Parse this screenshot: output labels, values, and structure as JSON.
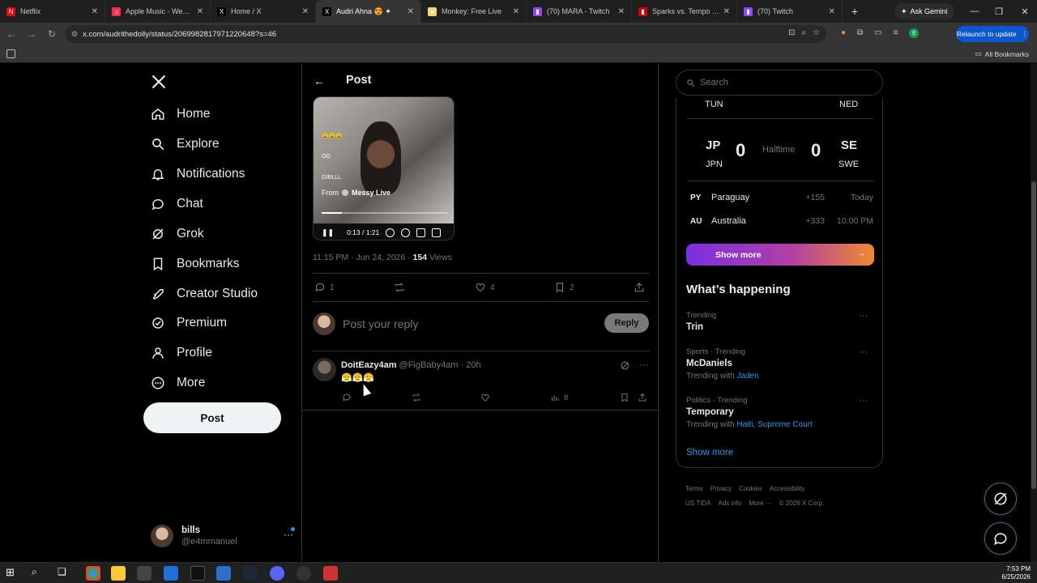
{
  "browser": {
    "tabs": [
      {
        "title": "Netflix",
        "fav_color": "#e50914",
        "fav": "N"
      },
      {
        "title": "Apple Music - Web Pla...",
        "fav_color": "#fa2d48",
        "fav": "♫"
      },
      {
        "title": "Home / X",
        "fav_color": "#000000",
        "fav": "X"
      },
      {
        "title": "Audri Ahna 😍 ✦",
        "fav_color": "#000000",
        "fav": "X"
      },
      {
        "title": "Monkey: Free Live",
        "fav_color": "#f5d76e",
        "fav": "●"
      },
      {
        "title": "(70) MARA - Twitch",
        "fav_color": "#9146ff",
        "fav": "▮"
      },
      {
        "title": "Sparks vs. Tempo (Jun...",
        "fav_color": "#d40000",
        "fav": "▮"
      },
      {
        "title": "(70) Twitch",
        "fav_color": "#9146ff",
        "fav": "▮"
      }
    ],
    "ask_gemini": "Ask Gemini",
    "url": "x.com/audrithedolly/status/2069982817971220648?s=46",
    "relaunch": "Relaunch to update",
    "all_bookmarks": "All Bookmarks"
  },
  "nav": {
    "items": [
      {
        "label": "Home",
        "icon": "home-icon"
      },
      {
        "label": "Explore",
        "icon": "search-icon"
      },
      {
        "label": "Notifications",
        "icon": "bell-icon"
      },
      {
        "label": "Chat",
        "icon": "chat-icon"
      },
      {
        "label": "Grok",
        "icon": "grok-icon"
      },
      {
        "label": "Bookmarks",
        "icon": "bookmark-icon"
      },
      {
        "label": "Creator Studio",
        "icon": "rocket-icon"
      },
      {
        "label": "Premium",
        "icon": "verified-icon"
      },
      {
        "label": "Profile",
        "icon": "person-icon"
      },
      {
        "label": "More",
        "icon": "more-circle-icon"
      }
    ],
    "post_button": "Post",
    "account": {
      "name": "bills",
      "handle": "@e4mmanuel"
    }
  },
  "post": {
    "header_title": "Post",
    "video": {
      "comments": [
        "😩😩😩",
        "GG",
        "GIRLLL"
      ],
      "from_label": "From",
      "from_source": "Messy Live",
      "time": "0:13 / 1:21",
      "progress": 0.16
    },
    "time": "11:15 PM · Jun 24, 2026 · ",
    "views_count": "154",
    "views_label": " Views",
    "replies": "1",
    "likes": "4",
    "bookmarks": "2",
    "reply_placeholder": "Post your reply",
    "reply_button": "Reply"
  },
  "comment": {
    "name": "DoitEazy4am",
    "handle": "@FigBaby4am · 20h",
    "body": "😤😤😤",
    "views": "8"
  },
  "right": {
    "search_placeholder": "Search",
    "top_left_code": "TUN",
    "top_right_code": "NED",
    "match": {
      "left_code": "JP",
      "left_name": "JPN",
      "left_score": "0",
      "status": "Halftime",
      "right_score": "0",
      "right_code": "SE",
      "right_name": "SWE"
    },
    "rows": [
      {
        "code": "PY",
        "name": "Paraguay",
        "odds": "+155",
        "time": "Today"
      },
      {
        "code": "AU",
        "name": "Australia",
        "odds": "+333",
        "time": "10:00 PM"
      }
    ],
    "show_more_sports": "Show more",
    "whats_happening": "What’s happening",
    "trends": [
      {
        "context": "Trending",
        "name": "Trin",
        "with_label": "",
        "with": ""
      },
      {
        "context": "Sports · Trending",
        "name": "McDaniels",
        "with_label": "Trending with ",
        "with": "Jaden"
      },
      {
        "context": "Politics · Trending",
        "name": "Temporary",
        "with_label": "Trending with ",
        "with": "Haiti, Supreme Court"
      }
    ],
    "show_more": "Show more",
    "footer_line1": [
      "Terms",
      "Privacy",
      "Cookies",
      "Accessibility"
    ],
    "footer_line2": [
      "US TIDA",
      "Ads info",
      "More ···",
      "© 2026 X Corp."
    ]
  },
  "taskbar": {
    "time": "7:53 PM",
    "date": "6/25/2026"
  }
}
